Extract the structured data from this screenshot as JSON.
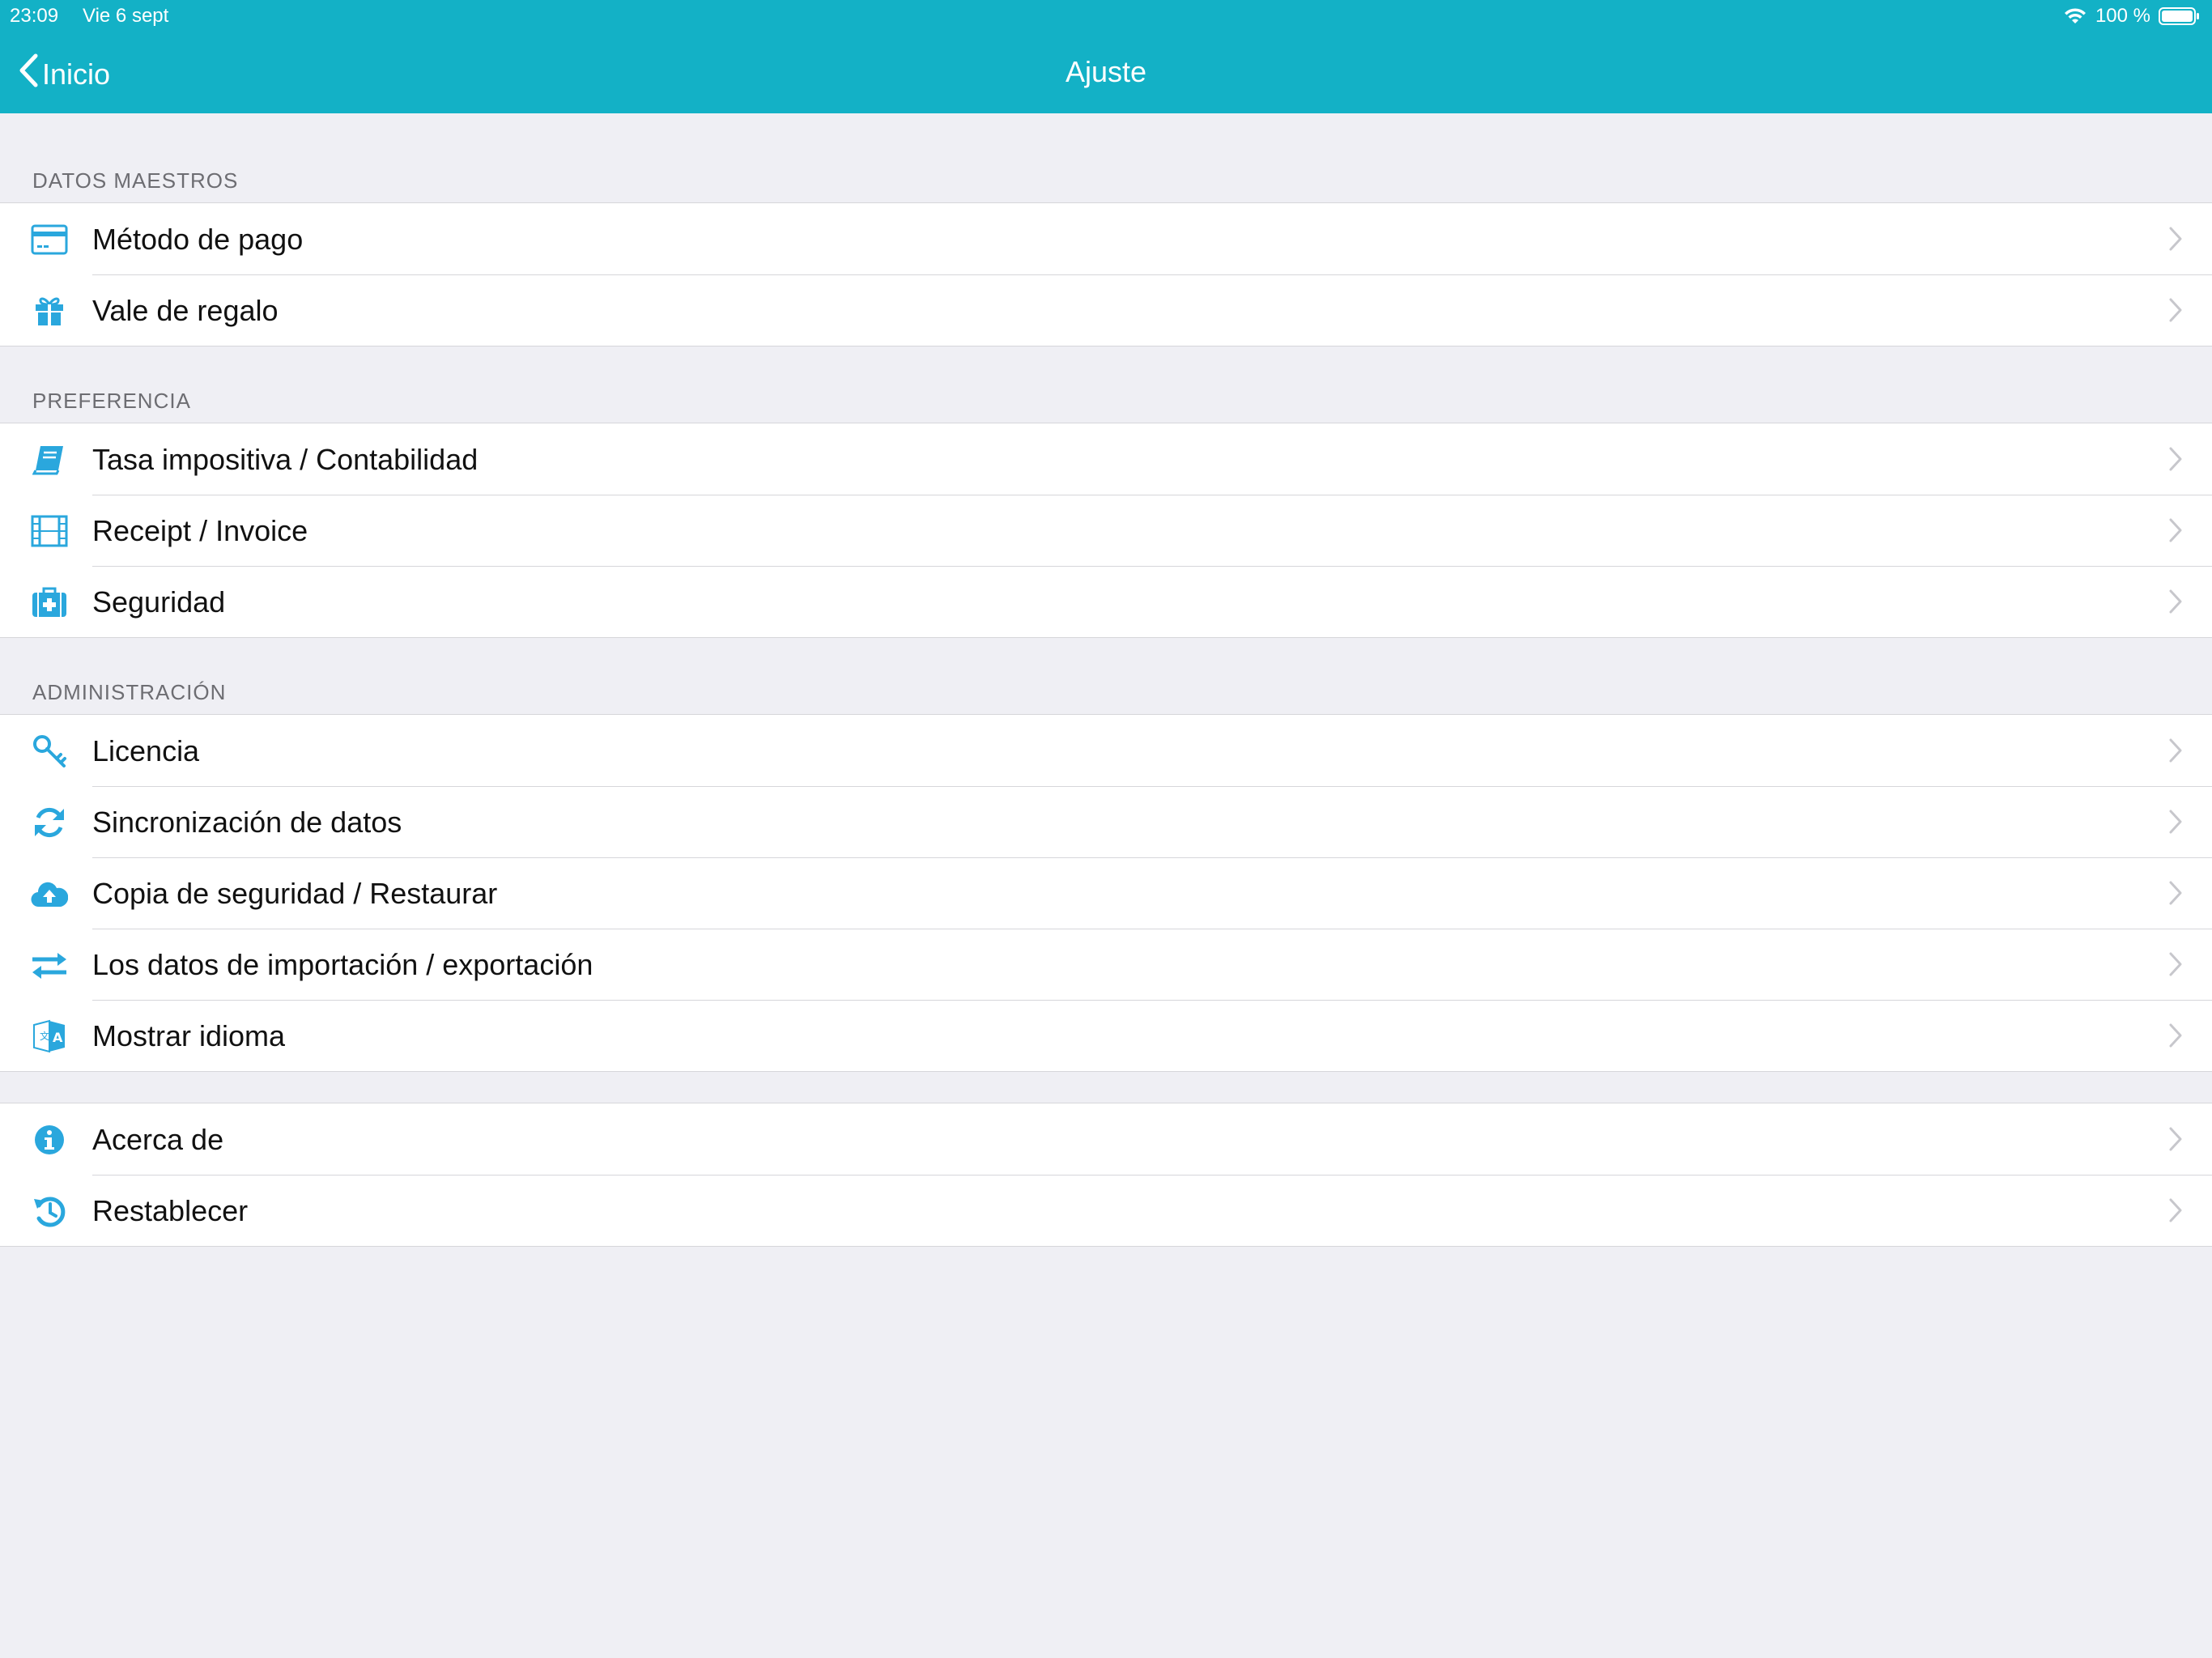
{
  "status_bar": {
    "time": "23:09",
    "date": "Vie 6 sept",
    "battery": "100 %"
  },
  "nav": {
    "back_label": "Inicio",
    "title": "Ajuste"
  },
  "colors": {
    "accent": "#13b1c6",
    "icon": "#2aa7dd",
    "background": "#efeff4"
  },
  "sections": [
    {
      "header": "DATOS MAESTROS",
      "items": [
        {
          "label": "Método de pago",
          "icon": "credit-card-icon"
        },
        {
          "label": "Vale de regalo",
          "icon": "gift-icon"
        }
      ]
    },
    {
      "header": "PREFERENCIA",
      "items": [
        {
          "label": "Tasa impositiva / Contabilidad",
          "icon": "book-icon"
        },
        {
          "label": "Receipt / Invoice",
          "icon": "film-icon"
        },
        {
          "label": "Seguridad",
          "icon": "medkit-icon"
        }
      ]
    },
    {
      "header": "ADMINISTRACIÓN",
      "items": [
        {
          "label": "Licencia",
          "icon": "key-icon"
        },
        {
          "label": "Sincronización de datos",
          "icon": "sync-icon"
        },
        {
          "label": "Copia de seguridad / Restaurar",
          "icon": "cloud-upload-icon"
        },
        {
          "label": "Los datos de importación / exportación",
          "icon": "exchange-icon"
        },
        {
          "label": "Mostrar idioma",
          "icon": "language-icon"
        }
      ]
    },
    {
      "header": "",
      "items": [
        {
          "label": "Acerca de",
          "icon": "info-icon"
        },
        {
          "label": "Restablecer",
          "icon": "history-icon"
        }
      ]
    }
  ]
}
